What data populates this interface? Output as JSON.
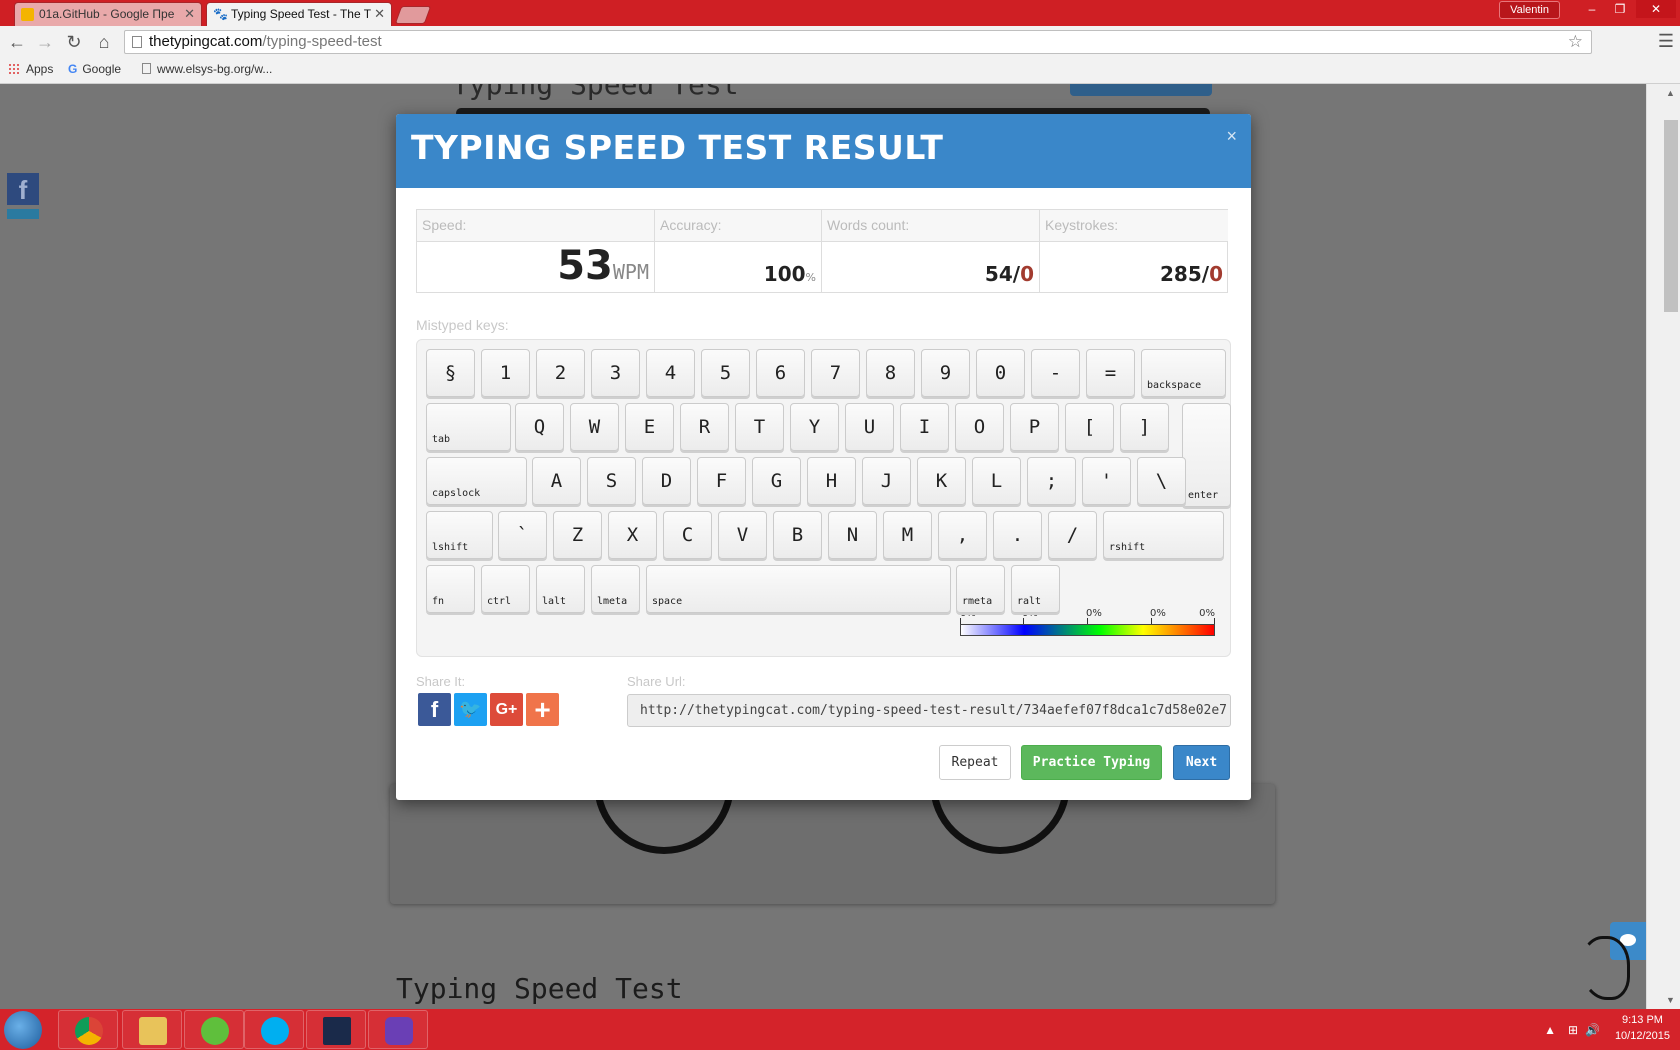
{
  "browser": {
    "tabs": [
      {
        "label": "01a.GitHub - Google Пре",
        "active": false
      },
      {
        "label": "Typing Speed Test - The T",
        "active": true
      }
    ],
    "user": "Valentin",
    "url_domain": "thetypingcat.com",
    "url_path": "/typing-speed-test",
    "bookmarks": [
      "Apps",
      "Google",
      "www.elsys-bg.org/w..."
    ]
  },
  "background": {
    "title_top": "Typing Speed Test",
    "title_bottom": "Typing Speed Test"
  },
  "modal": {
    "title": "TYPING SPEED TEST RESULT",
    "close": "×",
    "stats": {
      "speed_label": "Speed:",
      "speed_value": "53",
      "speed_unit": "WPM",
      "accuracy_label": "Accuracy:",
      "accuracy_value": "100",
      "accuracy_unit": "%",
      "words_label": "Words count:",
      "words_correct": "54",
      "words_sep": "/",
      "words_errors": "0",
      "keystrokes_label": "Keystrokes:",
      "keystrokes_correct": "285",
      "keystrokes_sep": "/",
      "keystrokes_errors": "0"
    },
    "mistyped_label": "Mistyped keys:",
    "legend_labels": [
      "0%",
      "0%",
      "0%",
      "0%",
      "0%"
    ],
    "share_label": "Share It:",
    "share_url_label": "Share Url:",
    "share_url": "http://thetypingcat.com/typing-speed-test-result/734aefef07f8dca1c7d58e02e7",
    "buttons": {
      "repeat": "Repeat",
      "practice": "Practice Typing",
      "next": "Next"
    }
  },
  "keyboard": {
    "row1": [
      "§",
      "1",
      "2",
      "3",
      "4",
      "5",
      "6",
      "7",
      "8",
      "9",
      "0",
      "-",
      "="
    ],
    "row1_end": "backspace",
    "row2_start": "tab",
    "row2": [
      "Q",
      "W",
      "E",
      "R",
      "T",
      "Y",
      "U",
      "I",
      "O",
      "P",
      "[",
      "]"
    ],
    "row2_end": "enter",
    "row3_start": "capslock",
    "row3": [
      "A",
      "S",
      "D",
      "F",
      "G",
      "H",
      "J",
      "K",
      "L",
      ";",
      "'",
      "\\"
    ],
    "row4_start": "lshift",
    "row4": [
      "`",
      "Z",
      "X",
      "C",
      "V",
      "B",
      "N",
      "M",
      ",",
      ".",
      "/"
    ],
    "row4_end": "rshift",
    "row5": [
      "fn",
      "ctrl",
      "lalt",
      "lmeta",
      "space",
      "rmeta",
      "ralt"
    ]
  },
  "taskbar": {
    "time": "9:13 PM",
    "date": "10/12/2015"
  },
  "colors": {
    "accent": "#3a87c9",
    "practice_green": "#5cb85c",
    "error_red": "#a23b2f",
    "chrome_red": "#cf1f24"
  }
}
